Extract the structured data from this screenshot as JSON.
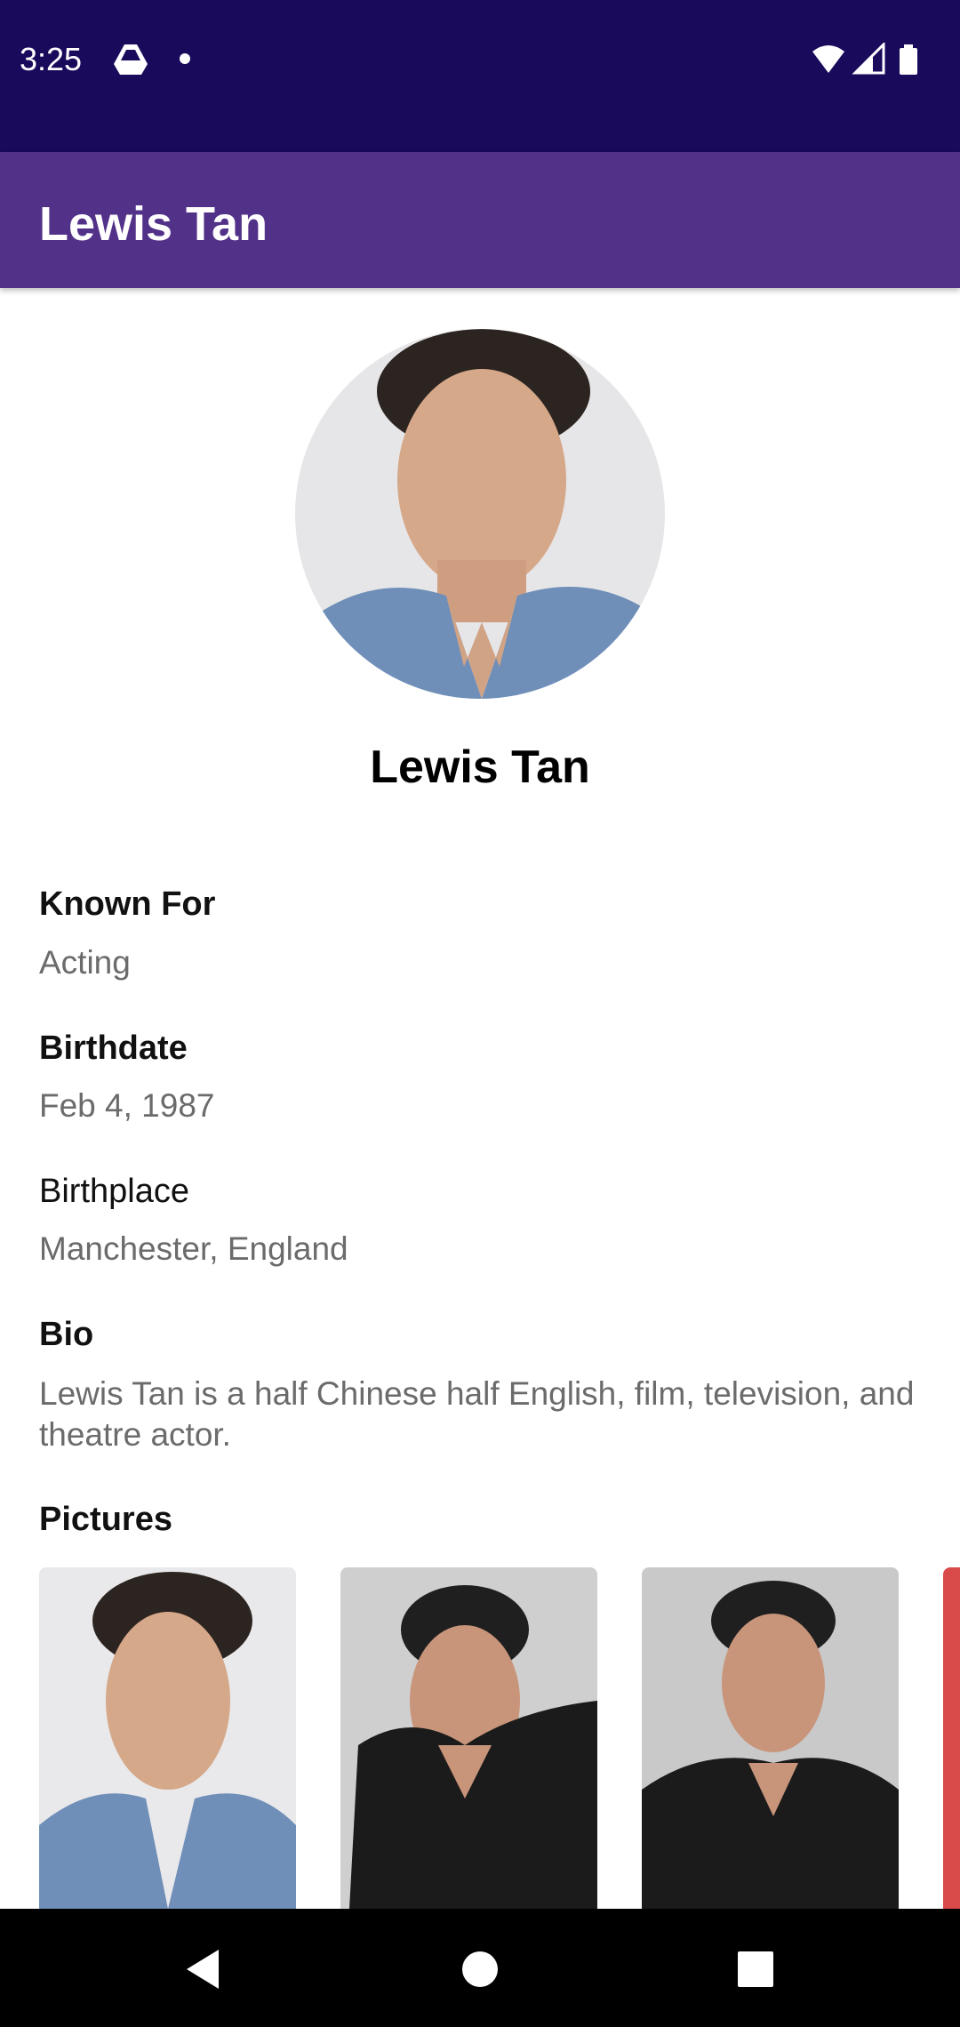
{
  "status_bar": {
    "time": "3:25",
    "icons": [
      "google-drive-icon",
      "notification-dot-icon",
      "wifi-icon",
      "cell-signal-icon",
      "battery-icon"
    ]
  },
  "app_bar": {
    "title": "Lewis Tan",
    "color": "#523189"
  },
  "profile": {
    "name": "Lewis Tan",
    "known_for_label": "Known For",
    "known_for": "Acting",
    "birthdate_label": "Birthdate",
    "birthdate": "Feb 4, 1987",
    "birthplace_label": "Birthplace",
    "birthplace": "Manchester, England",
    "bio_label": "Bio",
    "bio": "Lewis Tan is a half Chinese half English, film, television, and theatre actor.",
    "pictures_label": "Pictures"
  },
  "nav_bar": {
    "buttons": [
      "back-icon",
      "home-icon",
      "recents-icon"
    ]
  }
}
